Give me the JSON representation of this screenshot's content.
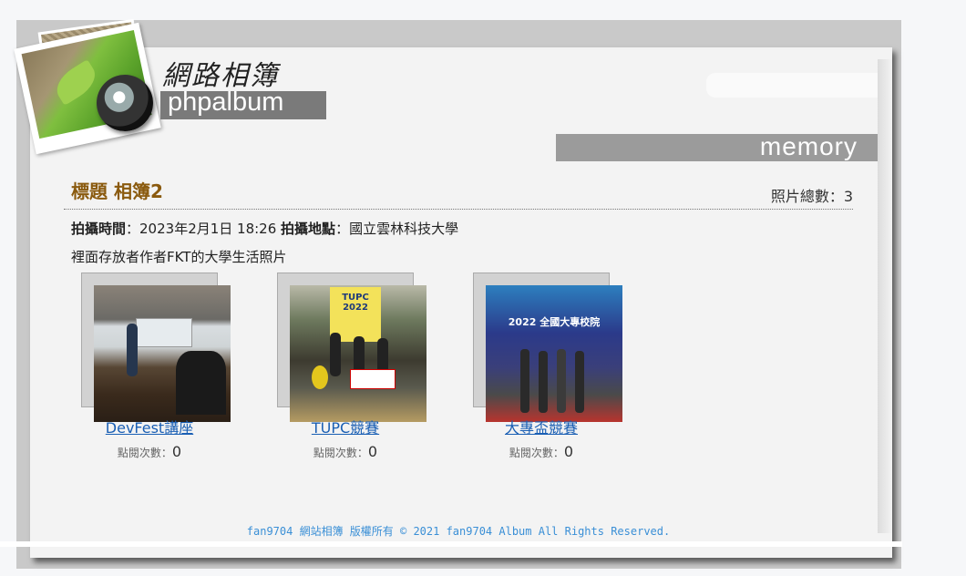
{
  "header": {
    "logo_title": "網路相簿",
    "logo_subtitle": "phpalbum",
    "tagline": "memory"
  },
  "album": {
    "title": "標題 相簿2",
    "photo_count_label": "照片總數：3",
    "time_label": "拍攝時間",
    "time_value": "：2023年2月1日 18:26 ",
    "place_label": "拍攝地點",
    "place_value": "：國立雲林科技大學",
    "description": "裡面存放者作者FKT的大學生活照片"
  },
  "photos": [
    {
      "caption": "DevFest講座",
      "views_label": "點閱次數：",
      "views": "0"
    },
    {
      "caption": "TUPC競賽",
      "views_label": "點閱次數：",
      "views": "0",
      "image_text": "TUPC 2022"
    },
    {
      "caption": "大專盃競賽",
      "views_label": "點閱次數：",
      "views": "0",
      "image_text": "2022 全國大專校院"
    }
  ],
  "footer": {
    "text": "fan9704 網站相簿 版權所有 © 2021 fan9704 Album All Rights Reserved."
  }
}
